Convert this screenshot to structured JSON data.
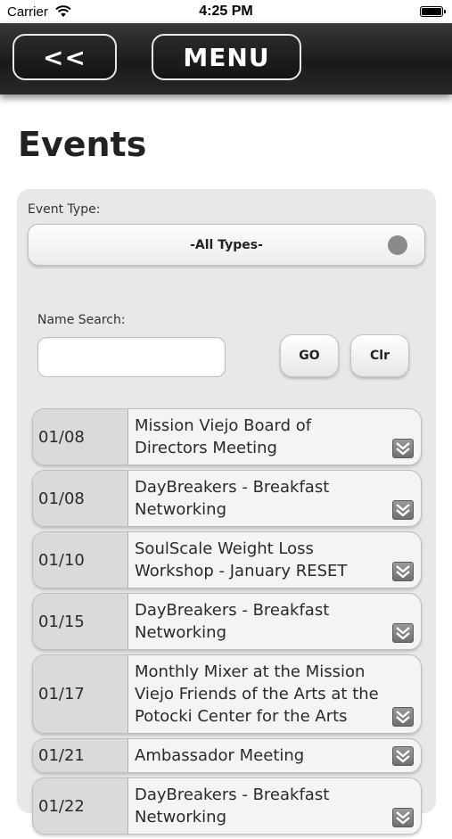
{
  "status_bar": {
    "carrier": "Carrier",
    "time": "4:25 PM"
  },
  "nav": {
    "back_label": "<<",
    "menu_label": "MENU"
  },
  "page": {
    "title": "Events"
  },
  "filters": {
    "event_type_label": "Event Type:",
    "event_type_value": "-All Types-",
    "name_search_label": "Name Search:",
    "name_search_value": "",
    "go_label": "GO",
    "clear_label": "Clr"
  },
  "events": [
    {
      "date": "01/08",
      "title": "Mission Viejo Board of Directors Meeting"
    },
    {
      "date": "01/08",
      "title": "DayBreakers - Breakfast Networking"
    },
    {
      "date": "01/10",
      "title": "SoulScale Weight Loss Workshop - January RESET"
    },
    {
      "date": "01/15",
      "title": "DayBreakers - Breakfast Networking"
    },
    {
      "date": "01/17",
      "title": "Monthly Mixer at the Mission Viejo Friends of the Arts at the Potocki Center for the Arts"
    },
    {
      "date": "01/21",
      "title": "Ambassador Meeting"
    },
    {
      "date": "01/22",
      "title": "DayBreakers - Breakfast Networking"
    }
  ],
  "icons": {
    "status": [
      "wifi-icon",
      "battery-icon"
    ],
    "select": "dropdown-indicator-icon",
    "row": "chevron-down-icon"
  },
  "colors": {
    "navbar": "#1c1a18",
    "panel": "#e8e8e8",
    "chevron": "#7a7a7a"
  }
}
